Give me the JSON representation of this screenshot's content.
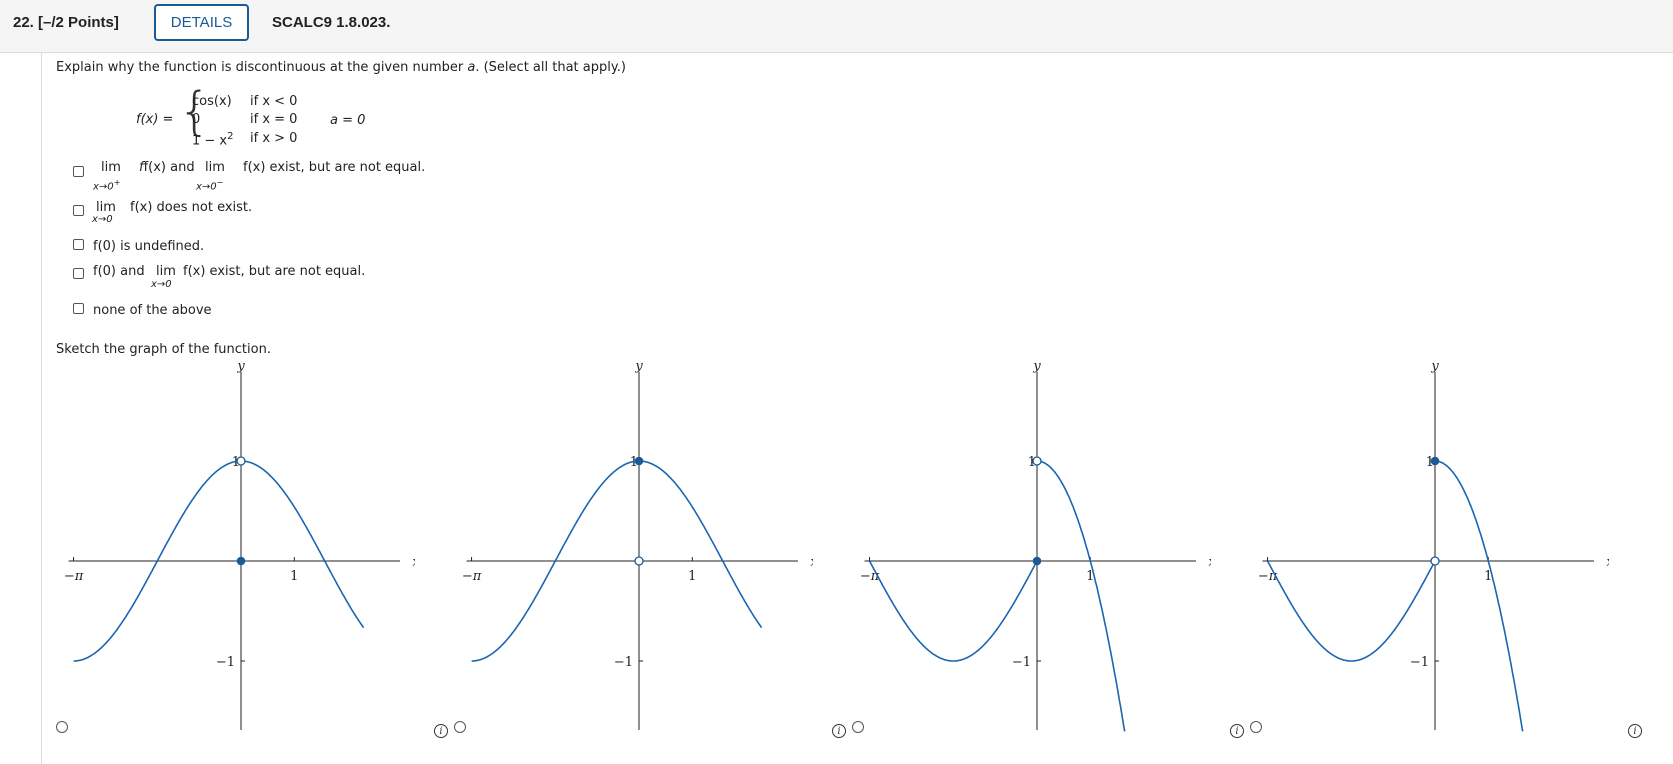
{
  "header": {
    "question_number": "22.",
    "points": "[–/2 Points]",
    "details_label": "DETAILS",
    "problem_code": "SCALC9 1.8.023."
  },
  "question": {
    "prompt": "Explain why the function is discontinuous at the given number",
    "prompt_var": "a",
    "prompt_suffix": ". (Select all that apply.)",
    "function": {
      "lhs": "f(x) =",
      "pieces": [
        {
          "expr": "cos(x)",
          "cond": "if x < 0"
        },
        {
          "expr": "0",
          "cond": "if x = 0"
        },
        {
          "expr": "1 − x",
          "exp": "2",
          "cond": "if x > 0"
        }
      ],
      "point": "a = 0"
    }
  },
  "options": [
    {
      "lim1": "lim",
      "sub1": "x→0",
      "sup1": "+",
      "text1": "f(x) and",
      "lim2": "lim",
      "sub2": "x→0",
      "sup2": "−",
      "text2": "f(x) exist, but are not equal."
    },
    {
      "lim": "lim",
      "sub": "x→0",
      "text": "f(x) does not exist."
    },
    {
      "text": "f(0) is undefined."
    },
    {
      "text_a": "f(0) and",
      "lim": "lim",
      "sub": "x→0",
      "text_b": "f(x) exist, but are not equal."
    },
    {
      "text": "none of the above"
    }
  ],
  "sketch_prompt": "Sketch the graph of the function.",
  "graph_labels": {
    "x": "x",
    "y": "y",
    "neg_pi": "−π",
    "one": "1",
    "neg_one": "−1",
    "y_one": "1"
  },
  "graph_choices": [
    {
      "left_piece": "cos(x)",
      "right_piece": "cos(x)",
      "point_at_x0": 0,
      "open_at": [
        1
      ]
    },
    {
      "left_piece": "cos(x)",
      "right_piece": "cos(x)",
      "point_at_x0": 1,
      "open_at": [
        0
      ]
    },
    {
      "left_piece": "sin(x)",
      "right_piece": "1 − x²",
      "point_at_x0": 0,
      "open_at": [
        1
      ]
    },
    {
      "left_piece": "sin(x)",
      "right_piece": "1 − x²",
      "point_at_x0": 1,
      "open_at": [
        0
      ]
    }
  ],
  "colors": {
    "curve": "#1a66b0",
    "dot": "#1a5a96",
    "accent": "#1a5a96"
  }
}
